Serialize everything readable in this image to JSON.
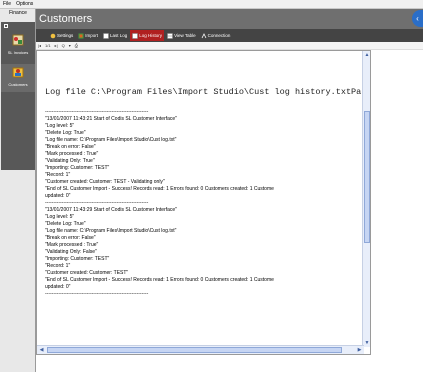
{
  "menu": [
    "File",
    "Options"
  ],
  "sidebar": {
    "title": "Finance",
    "items": [
      {
        "label": "SL Invoices",
        "icon": "invoice-icon"
      },
      {
        "label": "Customers",
        "icon": "customers-icon"
      }
    ]
  },
  "window": {
    "title": "Customers"
  },
  "toolbar": {
    "items": [
      {
        "label": "Settings",
        "icon": "settings-icon"
      },
      {
        "label": "Import",
        "icon": "import-icon"
      },
      {
        "label": "Last Log",
        "icon": "last-log-icon"
      },
      {
        "label": "Log History",
        "icon": "log-history-icon",
        "active": true
      },
      {
        "label": "View Table",
        "icon": "view-table-icon"
      },
      {
        "label": "Connection",
        "icon": "connection-icon"
      }
    ]
  },
  "report_toolbar": {
    "page": "1/1",
    "zoom": "Q"
  },
  "log": {
    "header": "Log file C:\\Program Files\\Import Studio\\Cust log history.txtPa",
    "lines": [
      "--------------------------------------------------------------",
      "\"13/01/2007 11:43:21 Start of Codis SL Customer Interface\"",
      "\"Log level:  5\"",
      "\"Delete Log: True\"",
      "\"Log file name: C:\\Program Files\\Import Studio\\Cust log.txt\"",
      "\"Break on error: False\"",
      "\"Mark processed : True\"",
      "\"Validating Only: True\"",
      "\"Importing: Customer: TEST\"",
      "\"Record: 1\"",
      "\"Customer created: Customer: TEST - Validating only\"",
      "\"End of SL Customer Import - Success! Records read:  1 Errors found:  0 Customers created:  1 Custome",
      "updated:  0\"",
      "--------------------------------------------------------------",
      "\"13/01/2007 11:43:29 Start of Codis SL Customer Interface\"",
      "\"Log level:  5\"",
      "\"Delete Log: True\"",
      "\"Log file name: C:\\Program Files\\Import Studio\\Cust log.txt\"",
      "\"Break on error: False\"",
      "\"Mark processed : True\"",
      "\"Validating Only: False\"",
      "\"Importing: Customer: TEST\"",
      "\"Record: 1\"",
      "\"Customer created: Customer: TEST\"",
      "\"End of SL Customer Import - Success! Records read:  1 Errors found:  0 Customers created:  1 Custome",
      "updated:  0\"",
      "--------------------------------------------------------------"
    ]
  },
  "colors": {
    "active_tab": "#b02020",
    "toolbar_bg": "#444444",
    "title_bg": "#6f6f6f",
    "scroll": "#c6d5f3"
  }
}
